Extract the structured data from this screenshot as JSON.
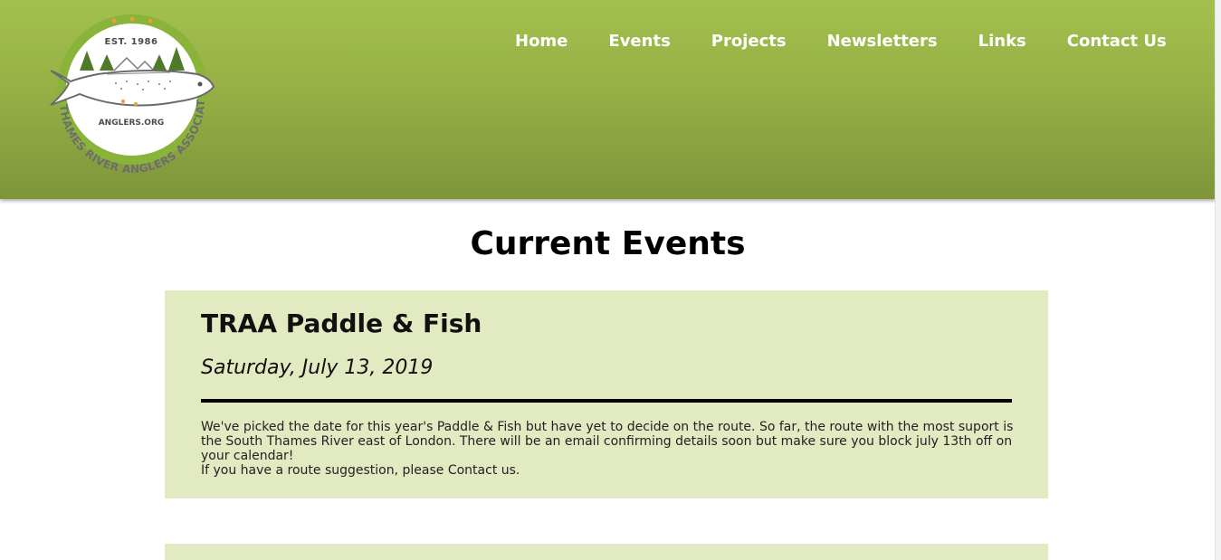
{
  "header": {
    "logo": {
      "est": "EST. 1986",
      "site": "ANGLERS.ORG",
      "ring_text": "THAMES RIVER ANGLERS ASSOCIATION"
    },
    "nav": [
      {
        "label": "Home"
      },
      {
        "label": "Events"
      },
      {
        "label": "Projects"
      },
      {
        "label": "Newsletters"
      },
      {
        "label": "Links"
      },
      {
        "label": "Contact Us"
      }
    ]
  },
  "main": {
    "title": "Current Events",
    "events": [
      {
        "title": "TRAA Paddle & Fish",
        "date": "Saturday, July 13, 2019",
        "body": "We've picked the date for this year's Paddle & Fish but have yet to decide on the route. So far, the route with the most suport is the South Thames River east of London. There will be an email confirming details soon but make sure you block july 13th off on your calendar!",
        "body2": "If you have a route suggestion, please Contact us."
      }
    ]
  },
  "colors": {
    "header_top": "#a3c04d",
    "header_bottom": "#7e953a",
    "card_bg": "#e2eac1",
    "logo_ring": "#8ab33a",
    "tree_green": "#4e7a2a",
    "text": "#111111"
  }
}
